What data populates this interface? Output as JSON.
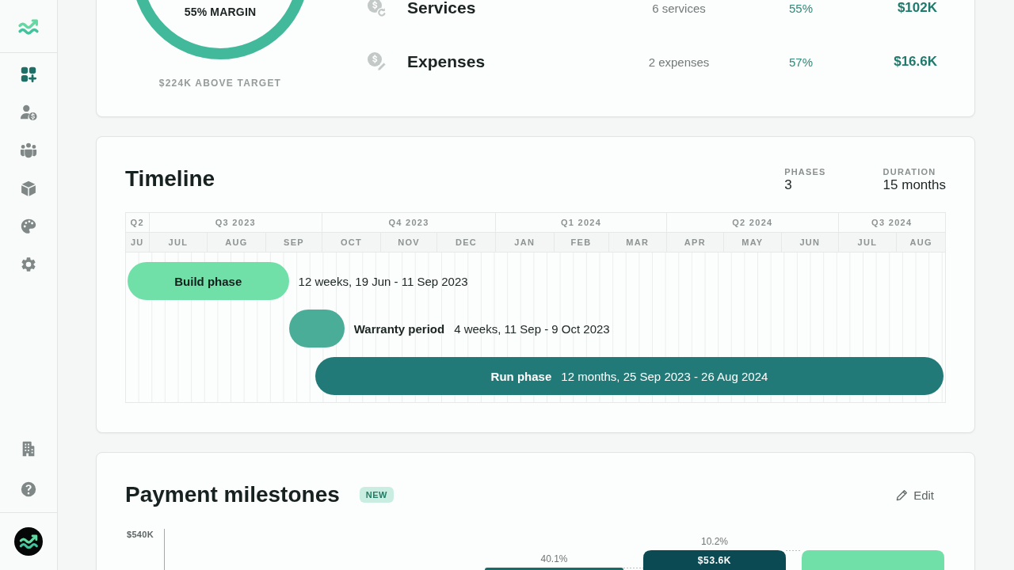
{
  "sidebar": {
    "nav_items": [
      {
        "selected": true
      },
      {
        "selected": false
      },
      {
        "selected": false
      },
      {
        "selected": false
      },
      {
        "selected": false
      },
      {
        "selected": false
      }
    ]
  },
  "summary": {
    "margin_label": "55% MARGIN",
    "target_note": "$224K ABOVE TARGET",
    "rows": [
      {
        "label": "Services",
        "count": "6 services",
        "percent": "55%",
        "amount": "$102K"
      },
      {
        "label": "Expenses",
        "count": "2 expenses",
        "percent": "57%",
        "amount": "$16.6K"
      }
    ]
  },
  "timeline": {
    "title": "Timeline",
    "stats": [
      {
        "label": "PHASES",
        "value": "3"
      },
      {
        "label": "DURATION",
        "value": "15 months"
      }
    ],
    "quarters": [
      {
        "label": "Q2",
        "months": [
          "JU"
        ]
      },
      {
        "label": "Q3 2023",
        "months": [
          "JUL",
          "AUG",
          "SEP"
        ]
      },
      {
        "label": "Q4 2023",
        "months": [
          "OCT",
          "NOV",
          "DEC"
        ]
      },
      {
        "label": "Q1 2024",
        "months": [
          "JAN",
          "FEB",
          "MAR"
        ]
      },
      {
        "label": "Q2 2024",
        "months": [
          "APR",
          "MAY",
          "JUN"
        ]
      },
      {
        "label": "Q3 2024",
        "months": [
          "JUL",
          "AUG"
        ]
      }
    ],
    "phases": [
      {
        "kind": "title-inside",
        "title": "Build phase",
        "detail": "12 weeks, 19 Jun - 11 Sep 2023",
        "color": "#70e0a8"
      },
      {
        "kind": "outside",
        "title": "Warranty period",
        "detail": "4 weeks, 11 Sep - 9 Oct 2023",
        "color": "#49ad98"
      },
      {
        "kind": "inside",
        "title": "Run phase",
        "detail": "12 months, 25 Sep 2023 - 26 Aug 2024",
        "color": "#217a77"
      }
    ]
  },
  "payments": {
    "title": "Payment milestones",
    "badge": "NEW",
    "edit_button": "Edit",
    "chart": {
      "axis_label": "$540K",
      "bars": [
        {
          "percent": "40.1%",
          "color": "#1c6b68"
        },
        {
          "percent": "10.2%",
          "value": "$53.6K",
          "color": "#0b4a52"
        },
        {
          "color": "#70e0a8"
        }
      ]
    }
  }
}
